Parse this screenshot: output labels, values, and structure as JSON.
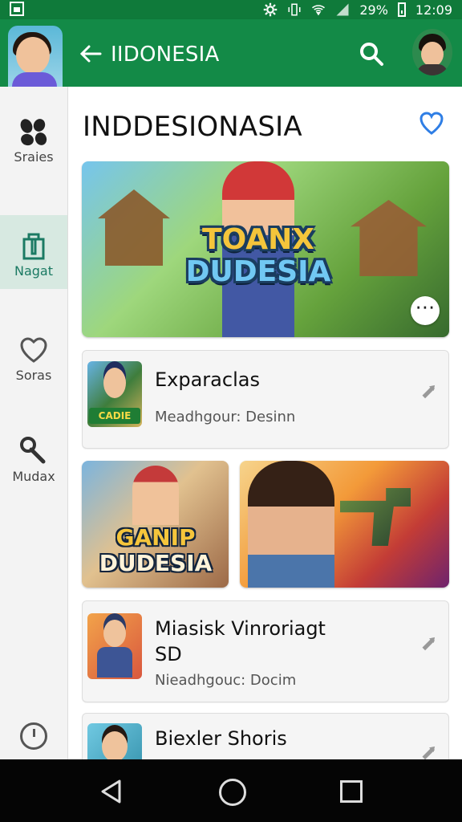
{
  "status_bar": {
    "battery": "29%",
    "time": "12:09"
  },
  "app_bar": {
    "title": "IIDONESIA"
  },
  "sidebar": {
    "items": [
      {
        "label": "Sraies",
        "icon": "cat-paws-icon"
      },
      {
        "label": "Nagat",
        "icon": "bag-icon"
      },
      {
        "label": "Soras",
        "icon": "heart-icon"
      },
      {
        "label": "Mudax",
        "icon": "wrench-icon"
      }
    ]
  },
  "main": {
    "page_title": "INDDESIONASIA",
    "hero": {
      "title_line1": "TOANX",
      "title_line2": "DUDESIA"
    },
    "cards": [
      {
        "title": "Exparaclas",
        "subtitle": "Meadhgour: Desinn",
        "thumb_text": "CADIE"
      },
      {
        "title": "Miasisk Vinroriagt SD",
        "subtitle": "Nieadhgouc: Docim"
      },
      {
        "title": "Biexler Shoris"
      }
    ],
    "tiles": [
      {
        "line1": "GANIP",
        "line2": "DUDESIA"
      }
    ]
  },
  "colors": {
    "green": "#138a47",
    "active": "#1b7a63",
    "navbar": "#050505"
  }
}
